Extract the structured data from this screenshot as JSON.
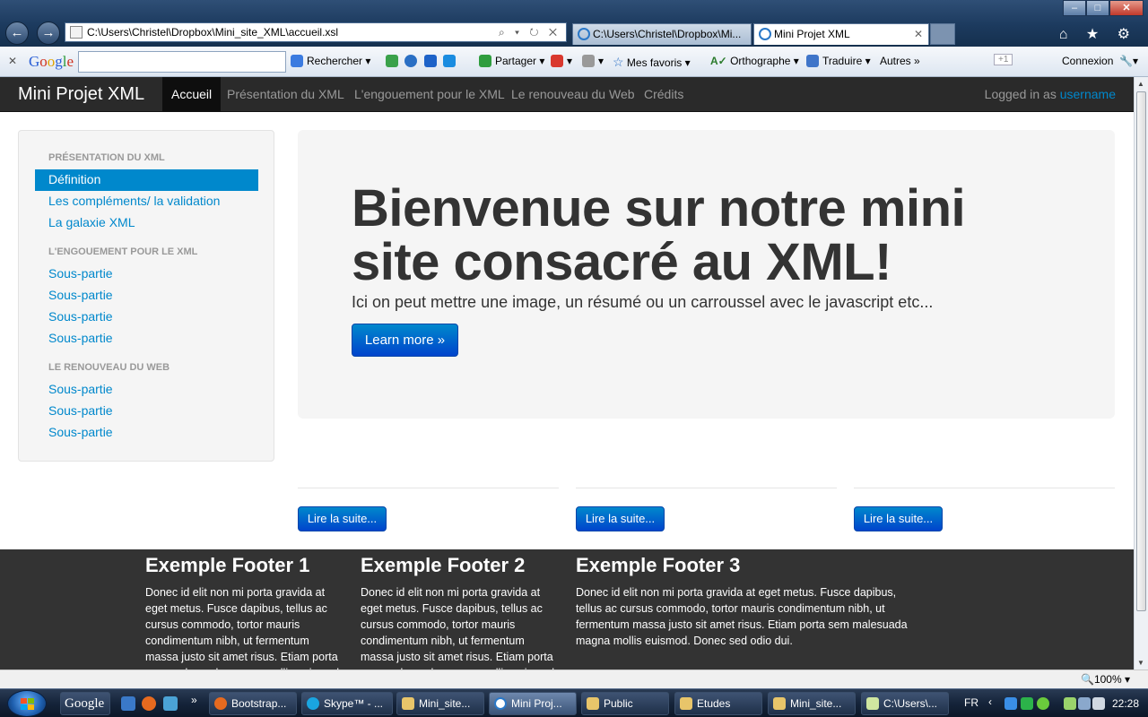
{
  "browser": {
    "address": "C:\\Users\\Christel\\Dropbox\\Mini_site_XML\\accueil.xsl",
    "tabs": [
      {
        "title": "C:\\Users\\Christel\\Dropbox\\Mi..."
      },
      {
        "title": "Mini Projet XML"
      }
    ],
    "window_controls": {
      "minimize": "–",
      "maximize": "□",
      "close": "✕"
    },
    "toolbar_icons": "⌂ ★ ⚙"
  },
  "google_toolbar": {
    "close": "✕",
    "logo": [
      "G",
      "o",
      "o",
      "g",
      "l",
      "e"
    ],
    "search_value": "",
    "items": [
      "Rechercher",
      "Partager",
      "Mes favoris",
      "Orthographe",
      "Traduire",
      "Autres »",
      "Connexion"
    ],
    "plus_one": "+1"
  },
  "navbar": {
    "brand": "Mini Projet XML",
    "links": [
      "Accueil",
      "Présentation du XML",
      "L'engouement pour le XML",
      "Le renouveau du Web",
      "Crédits"
    ],
    "logged_prefix": "Logged in as",
    "username": "username"
  },
  "sidebar": {
    "sections": [
      {
        "header": "PRÉSENTATION DU XML",
        "items": [
          "Définition",
          "Les compléments/ la validation",
          "La galaxie XML"
        ]
      },
      {
        "header": "L'ENGOUEMENT POUR LE XML",
        "items": [
          "Sous-partie",
          "Sous-partie",
          "Sous-partie",
          "Sous-partie"
        ]
      },
      {
        "header": "LE RENOUVEAU DU WEB",
        "items": [
          "Sous-partie",
          "Sous-partie",
          "Sous-partie"
        ]
      }
    ]
  },
  "hero": {
    "title": "Bienvenue sur notre mini site consacré au XML!",
    "text": "Ici on peut mettre une image, un résumé ou un carroussel avec le javascript etc...",
    "button": "Learn more »"
  },
  "columns": [
    {
      "button": "Lire la suite..."
    },
    {
      "button": "Lire la suite..."
    },
    {
      "button": "Lire la suite..."
    }
  ],
  "footer": [
    {
      "title": "Exemple Footer 1",
      "text": "Donec id elit non mi porta gravida at eget metus. Fusce dapibus, tellus ac cursus commodo, tortor mauris condimentum nibh, ut fermentum massa justo sit amet risus. Etiam porta sem malesuada magna mollis euismod."
    },
    {
      "title": "Exemple Footer 2",
      "text": "Donec id elit non mi porta gravida at eget metus. Fusce dapibus, tellus ac cursus commodo, tortor mauris condimentum nibh, ut fermentum massa justo sit amet risus. Etiam porta sem malesuada magna mollis euismod."
    },
    {
      "title": "Exemple Footer 3",
      "text": "Donec id elit non mi porta gravida at eget metus. Fusce dapibus, tellus ac cursus commodo, tortor mauris condimentum nibh, ut fermentum massa justo sit amet risus. Etiam porta sem malesuada magna mollis euismod. Donec sed odio dui."
    }
  ],
  "status_bar": {
    "zoom": "100%"
  },
  "taskbar": {
    "tasks": [
      "Google",
      "Bootstrap...",
      "Skype™ - ...",
      "Mini_site...",
      "Mini Proj...",
      "Public",
      "Etudes",
      "Mini_site...",
      "C:\\Users\\..."
    ],
    "quicklaunch_more": "»",
    "lang": "FR",
    "clock": "22:28"
  },
  "colors": {
    "accent": "#0088cc",
    "navbar": "#2a2a2a",
    "footer": "#333333"
  }
}
